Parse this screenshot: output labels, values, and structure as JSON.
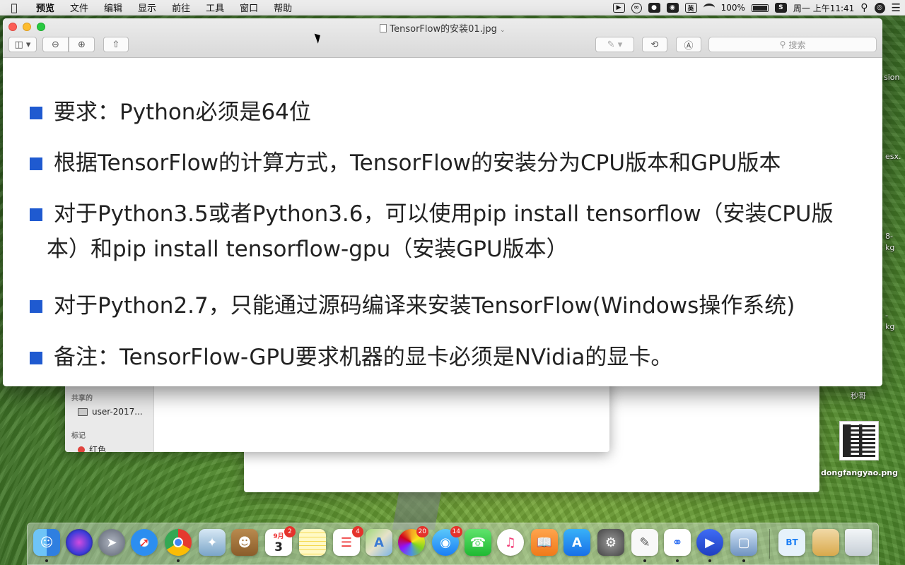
{
  "menubar": {
    "apple_icon": "apple-icon",
    "app_name": "预览",
    "items": [
      "文件",
      "编辑",
      "显示",
      "前往",
      "工具",
      "窗口",
      "帮助"
    ],
    "status": {
      "battery_text": "100%",
      "datetime": "周一 上午11:41",
      "icons": [
        "screen-record-icon",
        "creative-cloud-icon",
        "wechat-icon",
        "baidu-icon",
        "input-method-icon",
        "wifi-icon",
        "battery-icon",
        "s-app-icon",
        "search-icon",
        "siri-icon",
        "menu-list-icon"
      ],
      "input_method_label": "英"
    }
  },
  "preview_window": {
    "title": "TensorFlow的安装01.jpg",
    "search_placeholder": "搜索",
    "toolbar_icons": [
      "sidebar-toggle-icon",
      "zoom-out-icon",
      "zoom-in-icon",
      "share-icon",
      "markup-pen-icon",
      "rotate-icon",
      "annotate-icon"
    ]
  },
  "document": {
    "bullets": [
      {
        "lines": [
          "要求：Python必须是64位"
        ]
      },
      {
        "lines": [
          "根据TensorFlow的计算方式，TensorFlow的安装分为CPU版本和GPU版本"
        ]
      },
      {
        "lines": [
          "对于Python3.5或者Python3.6，可以使用pip install tensorflow（安装CPU版",
          "本）和pip install tensorflow-gpu（安装GPU版本）"
        ]
      },
      {
        "lines": [
          "对于Python2.7，只能通过源码编译来安装TensorFlow(Windows操作系统)"
        ]
      },
      {
        "lines": [
          "备注：TensorFlow-GPU要求机器的显卡必须是NVidia的显卡。"
        ]
      }
    ]
  },
  "finder": {
    "shared_section": "共享的",
    "shared_item": "user-2017...",
    "tags_section": "标记",
    "tag_item": "红色"
  },
  "desktop": {
    "partial_labels": [
      "sion",
      "esx.",
      "8-",
      "kg",
      "-",
      "kg"
    ],
    "folder_label": "秒哥",
    "qr_file_label": "dongfangyao.png"
  },
  "dock": {
    "apps": [
      {
        "name": "finder-icon",
        "badge": ""
      },
      {
        "name": "siri-icon",
        "badge": ""
      },
      {
        "name": "launchpad-icon",
        "badge": ""
      },
      {
        "name": "safari-icon",
        "badge": ""
      },
      {
        "name": "chrome-icon",
        "badge": ""
      },
      {
        "name": "mail-bird-icon",
        "badge": ""
      },
      {
        "name": "contacts-icon",
        "badge": ""
      },
      {
        "name": "calendar-icon",
        "badge": "2",
        "day": "3",
        "month": "9月"
      },
      {
        "name": "notes-icon",
        "badge": ""
      },
      {
        "name": "reminders-icon",
        "badge": "4"
      },
      {
        "name": "maps-icon",
        "badge": ""
      },
      {
        "name": "photos-icon",
        "badge": "20"
      },
      {
        "name": "messages-icon",
        "badge": "14"
      },
      {
        "name": "facetime-icon",
        "badge": ""
      },
      {
        "name": "itunes-icon",
        "badge": ""
      },
      {
        "name": "ibooks-icon",
        "badge": ""
      },
      {
        "name": "app-store-icon",
        "badge": ""
      },
      {
        "name": "system-preferences-icon",
        "badge": ""
      },
      {
        "name": "textedit-icon",
        "badge": ""
      },
      {
        "name": "baidu-netdisk-icon",
        "badge": ""
      },
      {
        "name": "video-app-icon",
        "badge": ""
      },
      {
        "name": "preview-icon",
        "badge": ""
      },
      {
        "name": "bt-download-icon",
        "badge": ""
      },
      {
        "name": "chrome-apps-folder-icon",
        "badge": ""
      },
      {
        "name": "trash-icon",
        "badge": ""
      }
    ]
  }
}
